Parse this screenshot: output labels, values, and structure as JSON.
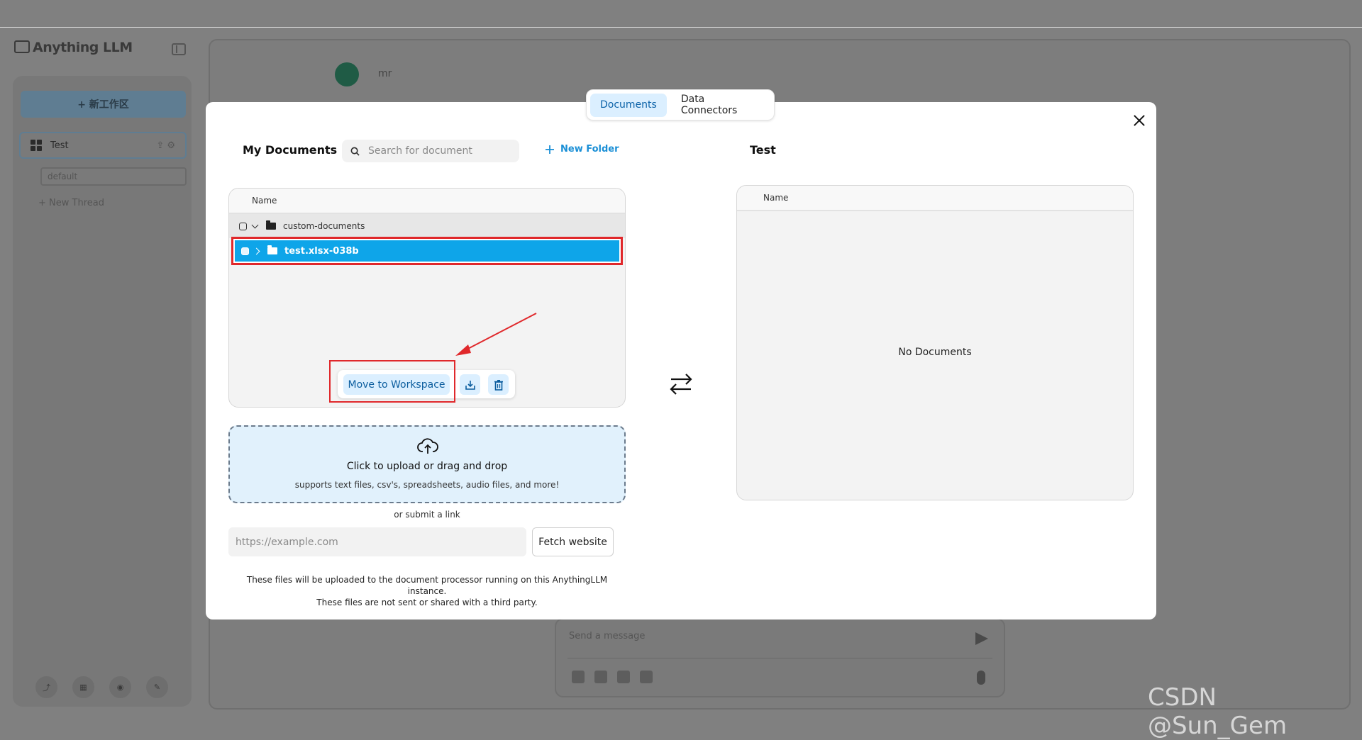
{
  "background": {
    "app_name": "Anything LLM",
    "new_workspace_label": "+ 新工作区",
    "workspace_name": "Test",
    "thread_name": "default",
    "new_thread_label": "+ New Thread",
    "user_label": "mr",
    "composer_placeholder": "Send a message"
  },
  "modal": {
    "tabs": [
      {
        "label": "Documents",
        "active": true
      },
      {
        "label": "Data Connectors",
        "active": false
      }
    ],
    "my_documents_title": "My Documents",
    "search_placeholder": "Search for document",
    "new_folder_label": "New Folder",
    "workspace_title": "Test",
    "file_table": {
      "column_header": "Name",
      "folder": "custom-documents",
      "selected_item": "test.xlsx-038b"
    },
    "actions": {
      "move_label": "Move to Workspace"
    },
    "workspace_table": {
      "column_header": "Name",
      "empty_text": "No Documents"
    },
    "upload": {
      "title": "Click to upload or drag and drop",
      "subtitle": "supports text files, csv's, spreadsheets, audio files, and more!",
      "or_link": "or submit a link",
      "url_placeholder": "https://example.com",
      "fetch_label": "Fetch website",
      "disclaimer_line1": "These files will be uploaded to the document processor running on this AnythingLLM instance.",
      "disclaimer_line2": "These files are not sent or shared with a third party."
    }
  },
  "watermark": "CSDN @Sun_Gem",
  "colors": {
    "accent_blue": "#0ea5e9",
    "highlight_red": "#e0282b",
    "tab_active_bg": "#dbefff"
  }
}
